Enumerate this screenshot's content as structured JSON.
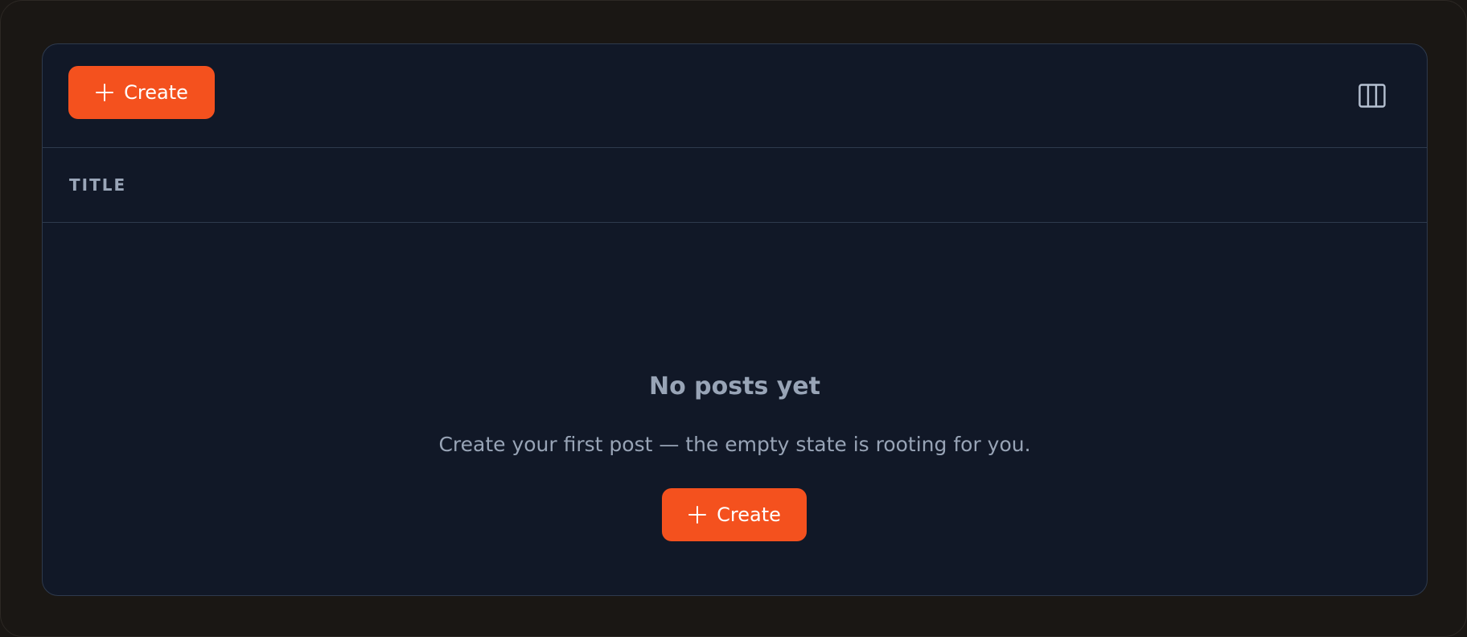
{
  "toolbar": {
    "create_label": "Create",
    "columns_icon": "columns-icon"
  },
  "table": {
    "columns": [
      "TITLE"
    ]
  },
  "empty_state": {
    "title": "No posts yet",
    "description": "Create your first post — the empty state is rooting for you.",
    "create_label": "Create"
  },
  "colors": {
    "accent": "#f4511e",
    "panel_bg": "#111827",
    "outer_bg": "#1a1714",
    "border": "#2e3a4d",
    "muted_text": "#98a4b6"
  }
}
